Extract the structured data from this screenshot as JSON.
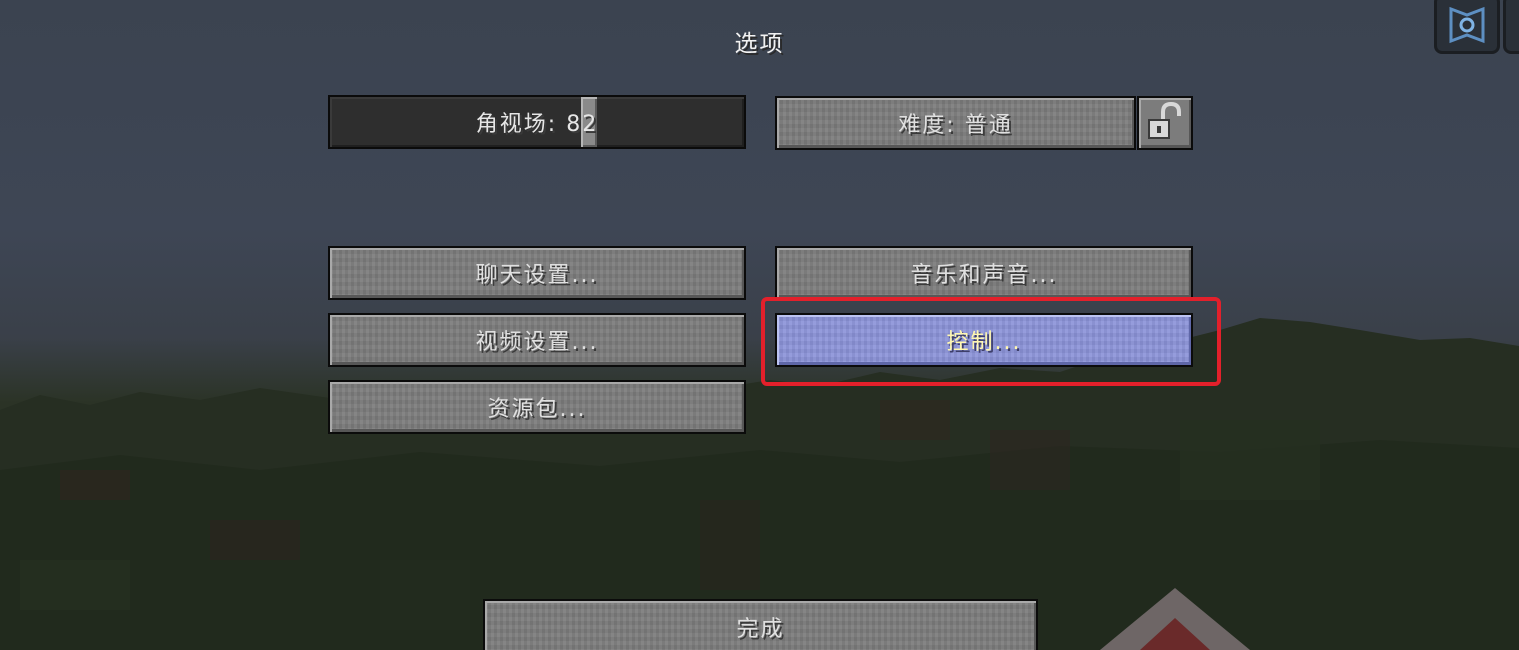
{
  "screen": {
    "title": "选项"
  },
  "fov_slider": {
    "label": "角视场: 82",
    "value": 82,
    "fill_fraction": 0.63
  },
  "difficulty_button": {
    "label": "难度: 普通"
  },
  "lock_button": {
    "icon": "unlocked-padlock-icon"
  },
  "buttons": {
    "chat_settings": "聊天设置...",
    "music_sounds": "音乐和声音...",
    "video_settings": "视频设置...",
    "controls": "控制...",
    "resource_packs": "资源包...",
    "done": "完成"
  },
  "annotation": {
    "highlight_color": "#e3202b",
    "highlighted_item": "controls"
  },
  "colors": {
    "button_gray": "#7c7c7c",
    "button_hover": "#8b93d8",
    "hover_text": "#fff7b0",
    "text": "#e0e0e0"
  }
}
